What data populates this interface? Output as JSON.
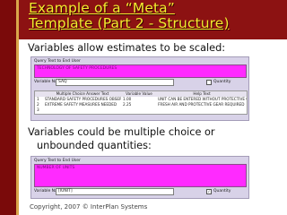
{
  "slide": {
    "title_line1": "Example of a “Meta”",
    "title_line2": "Template (Part 2 - Structure)",
    "bullet1": "Variables allow estimates to be scaled:",
    "bullet2_line1": "Variables could be multiple choice or",
    "bullet2_line2": "unbounded quantities:",
    "footer": "Copyright, 2007 © InterPlan Systems"
  },
  "panel1": {
    "heading": "Query Text to End User",
    "prompt": "TECHNOLOGY OF SAFETY PROCEDURES",
    "variable_label": "Variable Name",
    "variable_value": "SAQ",
    "quantity_label": "Quantity",
    "columns": [
      "",
      "Multiple Choice Answer Text",
      "Variable Value",
      "Help Text"
    ],
    "rows": [
      [
        "1",
        "STANDARD SAFETY PROCEDURES OBSERVED",
        "1.00",
        "UNIT CAN BE ENTERED WITHOUT PROTECTIVE GEAR"
      ],
      [
        "2",
        "EXTREME SAFETY MEASURES NEEDED",
        "2.25",
        "FRESH AIR AND PROTECTIVE GEAR REQUIRED"
      ],
      [
        "3",
        "",
        "",
        ""
      ]
    ]
  },
  "panel2": {
    "heading": "Query Text to End User",
    "prompt": "NUMBER OF UNITS",
    "variable_label": "Variable Name",
    "variable_value": "[IUNIT]",
    "quantity_label": "Quantity",
    "quantity_checked": true
  },
  "colors": {
    "title_band": "#8c1212",
    "title_text": "#f3ec2e",
    "accent_magenta": "#ff2aff"
  }
}
